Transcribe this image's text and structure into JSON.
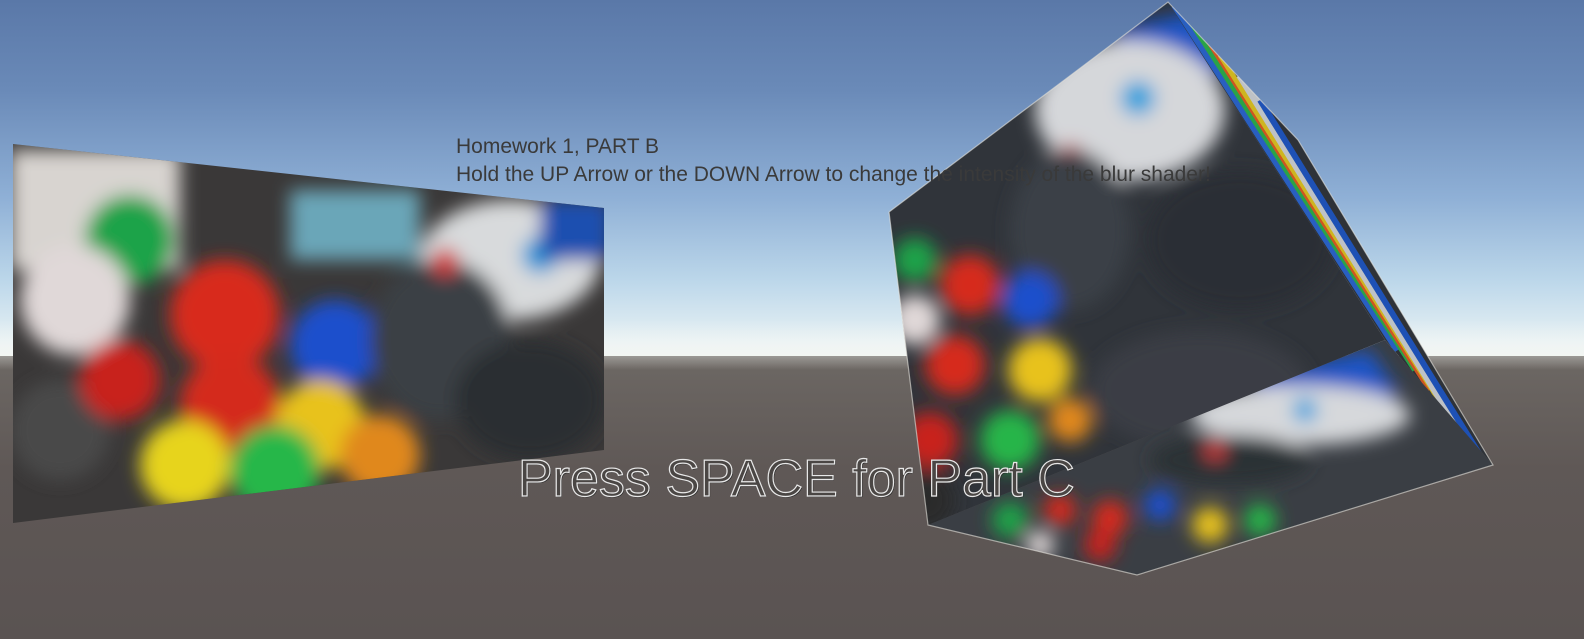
{
  "hud": {
    "title": "Homework 1, PART B",
    "instruction": "Hold the UP Arrow or the DOWN Arrow to change the intensity of the blur shader!"
  },
  "prompt": {
    "text": "Press SPACE for Part C"
  },
  "scene": {
    "sky_color": "#8fb0d6",
    "ground_color": "#5f5856",
    "objects": [
      "blurred-textured-quad",
      "blurred-textured-cube"
    ]
  }
}
